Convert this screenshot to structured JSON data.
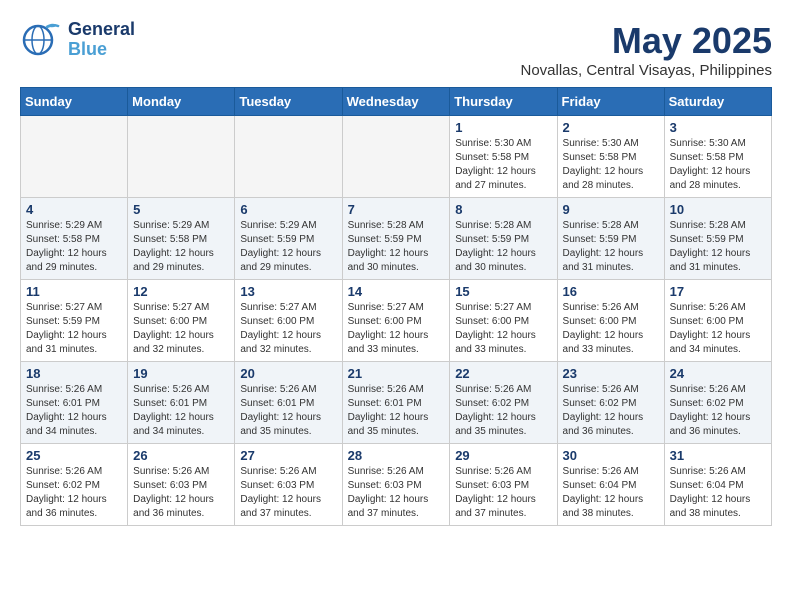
{
  "logo": {
    "line1": "General",
    "line2": "Blue"
  },
  "title": "May 2025",
  "location": "Novallas, Central Visayas, Philippines",
  "weekdays": [
    "Sunday",
    "Monday",
    "Tuesday",
    "Wednesday",
    "Thursday",
    "Friday",
    "Saturday"
  ],
  "weeks": [
    [
      {
        "day": "",
        "info": ""
      },
      {
        "day": "",
        "info": ""
      },
      {
        "day": "",
        "info": ""
      },
      {
        "day": "",
        "info": ""
      },
      {
        "day": "1",
        "info": "Sunrise: 5:30 AM\nSunset: 5:58 PM\nDaylight: 12 hours\nand 27 minutes."
      },
      {
        "day": "2",
        "info": "Sunrise: 5:30 AM\nSunset: 5:58 PM\nDaylight: 12 hours\nand 28 minutes."
      },
      {
        "day": "3",
        "info": "Sunrise: 5:30 AM\nSunset: 5:58 PM\nDaylight: 12 hours\nand 28 minutes."
      }
    ],
    [
      {
        "day": "4",
        "info": "Sunrise: 5:29 AM\nSunset: 5:58 PM\nDaylight: 12 hours\nand 29 minutes."
      },
      {
        "day": "5",
        "info": "Sunrise: 5:29 AM\nSunset: 5:58 PM\nDaylight: 12 hours\nand 29 minutes."
      },
      {
        "day": "6",
        "info": "Sunrise: 5:29 AM\nSunset: 5:59 PM\nDaylight: 12 hours\nand 29 minutes."
      },
      {
        "day": "7",
        "info": "Sunrise: 5:28 AM\nSunset: 5:59 PM\nDaylight: 12 hours\nand 30 minutes."
      },
      {
        "day": "8",
        "info": "Sunrise: 5:28 AM\nSunset: 5:59 PM\nDaylight: 12 hours\nand 30 minutes."
      },
      {
        "day": "9",
        "info": "Sunrise: 5:28 AM\nSunset: 5:59 PM\nDaylight: 12 hours\nand 31 minutes."
      },
      {
        "day": "10",
        "info": "Sunrise: 5:28 AM\nSunset: 5:59 PM\nDaylight: 12 hours\nand 31 minutes."
      }
    ],
    [
      {
        "day": "11",
        "info": "Sunrise: 5:27 AM\nSunset: 5:59 PM\nDaylight: 12 hours\nand 31 minutes."
      },
      {
        "day": "12",
        "info": "Sunrise: 5:27 AM\nSunset: 6:00 PM\nDaylight: 12 hours\nand 32 minutes."
      },
      {
        "day": "13",
        "info": "Sunrise: 5:27 AM\nSunset: 6:00 PM\nDaylight: 12 hours\nand 32 minutes."
      },
      {
        "day": "14",
        "info": "Sunrise: 5:27 AM\nSunset: 6:00 PM\nDaylight: 12 hours\nand 33 minutes."
      },
      {
        "day": "15",
        "info": "Sunrise: 5:27 AM\nSunset: 6:00 PM\nDaylight: 12 hours\nand 33 minutes."
      },
      {
        "day": "16",
        "info": "Sunrise: 5:26 AM\nSunset: 6:00 PM\nDaylight: 12 hours\nand 33 minutes."
      },
      {
        "day": "17",
        "info": "Sunrise: 5:26 AM\nSunset: 6:00 PM\nDaylight: 12 hours\nand 34 minutes."
      }
    ],
    [
      {
        "day": "18",
        "info": "Sunrise: 5:26 AM\nSunset: 6:01 PM\nDaylight: 12 hours\nand 34 minutes."
      },
      {
        "day": "19",
        "info": "Sunrise: 5:26 AM\nSunset: 6:01 PM\nDaylight: 12 hours\nand 34 minutes."
      },
      {
        "day": "20",
        "info": "Sunrise: 5:26 AM\nSunset: 6:01 PM\nDaylight: 12 hours\nand 35 minutes."
      },
      {
        "day": "21",
        "info": "Sunrise: 5:26 AM\nSunset: 6:01 PM\nDaylight: 12 hours\nand 35 minutes."
      },
      {
        "day": "22",
        "info": "Sunrise: 5:26 AM\nSunset: 6:02 PM\nDaylight: 12 hours\nand 35 minutes."
      },
      {
        "day": "23",
        "info": "Sunrise: 5:26 AM\nSunset: 6:02 PM\nDaylight: 12 hours\nand 36 minutes."
      },
      {
        "day": "24",
        "info": "Sunrise: 5:26 AM\nSunset: 6:02 PM\nDaylight: 12 hours\nand 36 minutes."
      }
    ],
    [
      {
        "day": "25",
        "info": "Sunrise: 5:26 AM\nSunset: 6:02 PM\nDaylight: 12 hours\nand 36 minutes."
      },
      {
        "day": "26",
        "info": "Sunrise: 5:26 AM\nSunset: 6:03 PM\nDaylight: 12 hours\nand 36 minutes."
      },
      {
        "day": "27",
        "info": "Sunrise: 5:26 AM\nSunset: 6:03 PM\nDaylight: 12 hours\nand 37 minutes."
      },
      {
        "day": "28",
        "info": "Sunrise: 5:26 AM\nSunset: 6:03 PM\nDaylight: 12 hours\nand 37 minutes."
      },
      {
        "day": "29",
        "info": "Sunrise: 5:26 AM\nSunset: 6:03 PM\nDaylight: 12 hours\nand 37 minutes."
      },
      {
        "day": "30",
        "info": "Sunrise: 5:26 AM\nSunset: 6:04 PM\nDaylight: 12 hours\nand 38 minutes."
      },
      {
        "day": "31",
        "info": "Sunrise: 5:26 AM\nSunset: 6:04 PM\nDaylight: 12 hours\nand 38 minutes."
      }
    ]
  ]
}
